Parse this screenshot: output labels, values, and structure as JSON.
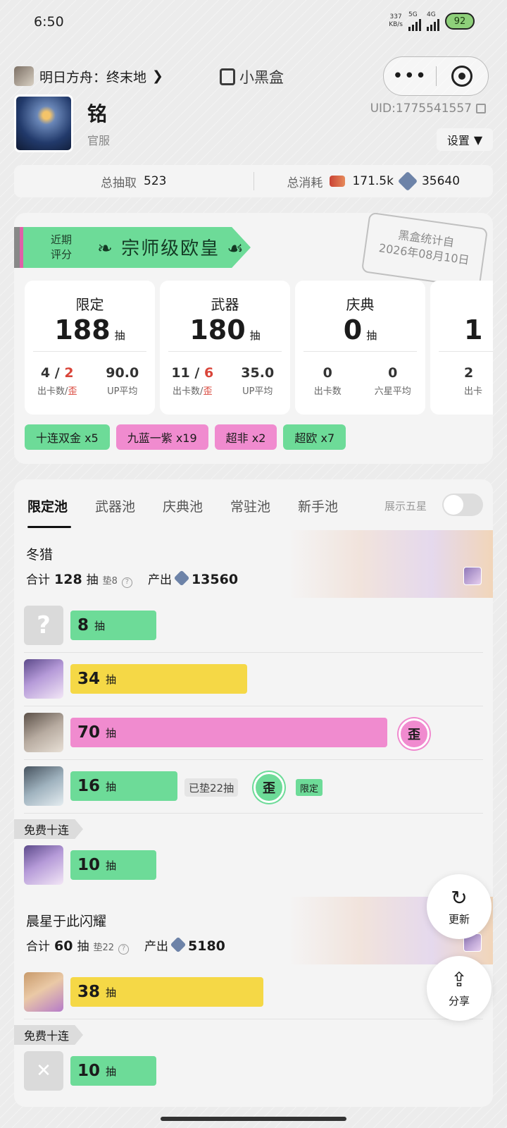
{
  "status": {
    "time": "6:50",
    "net_speed_top": "337",
    "net_speed_bottom": "KB/s",
    "sim1": "5G",
    "sim2": "4G",
    "battery": "92"
  },
  "header": {
    "game_title": "明日方舟：终末地",
    "brand": "小黑盒",
    "more": "•••"
  },
  "profile": {
    "name": "铭",
    "server": "官服",
    "uid": "UID:1775541557",
    "settings_label": "设置"
  },
  "totals": {
    "total_draws_label": "总抽取",
    "total_draws": "523",
    "total_cost_label": "总消耗",
    "cost1": "171.5k",
    "cost2": "35640"
  },
  "rating": {
    "label_line1": "近期",
    "label_line2": "评分",
    "title": "宗师级欧皇",
    "stamp_line1": "黑盒统计自",
    "stamp_line2": "2026年08月10日"
  },
  "pool_stats": [
    {
      "name": "限定",
      "count": "188",
      "unit": "抽",
      "a_val1": "4",
      "a_slash": " / ",
      "a_val2": "2",
      "a_label1": "出卡数",
      "a_label2": "歪",
      "b_val": "90.0",
      "b_label": "UP平均"
    },
    {
      "name": "武器",
      "count": "180",
      "unit": "抽",
      "a_val1": "11",
      "a_slash": " / ",
      "a_val2": "6",
      "a_label1": "出卡数",
      "a_label2": "歪",
      "b_val": "35.0",
      "b_label": "UP平均"
    },
    {
      "name": "庆典",
      "count": "0",
      "unit": "抽",
      "a_val1": "0",
      "a_label1": "出卡数",
      "b_val": "0",
      "b_label": "六星平均"
    },
    {
      "name": "",
      "count": "1",
      "unit": "",
      "a_val1": "2",
      "a_label1": "出卡"
    }
  ],
  "tags": [
    {
      "label": "十连双金 x5",
      "color": "green"
    },
    {
      "label": "九蓝一紫 x19",
      "color": "pink"
    },
    {
      "label": "超非 x2",
      "color": "pink"
    },
    {
      "label": "超欧 x7",
      "color": "green"
    }
  ],
  "tabs": [
    "限定池",
    "武器池",
    "庆典池",
    "常驻池",
    "新手池"
  ],
  "toggle_label": "展示五星",
  "pools": [
    {
      "name": "冬猎",
      "sum_label": "合计",
      "sum": "128",
      "unit": "抽",
      "pity": "垫8",
      "output_label": "产出",
      "output": "13560"
    },
    {
      "name": "晨星于此闪耀",
      "sum_label": "合计",
      "sum": "60",
      "unit": "抽",
      "pity": "垫22",
      "output_label": "产出",
      "output": "5180"
    }
  ],
  "draws": [
    {
      "count": "8",
      "unit": "抽",
      "color": "green",
      "avatar": "unknown-avatar"
    },
    {
      "count": "34",
      "unit": "抽",
      "color": "yellow",
      "avatar": "purple-hair-avatar"
    },
    {
      "count": "70",
      "unit": "抽",
      "color": "pink",
      "avatar": "grey-hair-avatar",
      "badge": "歪"
    },
    {
      "count": "16",
      "unit": "抽",
      "color": "green",
      "avatar": "silver-hair-avatar",
      "pity": "已垫22抽",
      "badge": "歪",
      "limited": "限定"
    },
    {
      "count": "10",
      "unit": "抽",
      "color": "green",
      "avatar": "purple-hair-avatar"
    },
    {
      "count": "38",
      "unit": "抽",
      "color": "yellow",
      "avatar": "blonde-avatar"
    },
    {
      "count": "10",
      "unit": "抽",
      "color": "green",
      "avatar": "empty-avatar"
    }
  ],
  "free_ten_label": "免费十连",
  "float": {
    "refresh_label": "更新",
    "share_label": "分享"
  }
}
